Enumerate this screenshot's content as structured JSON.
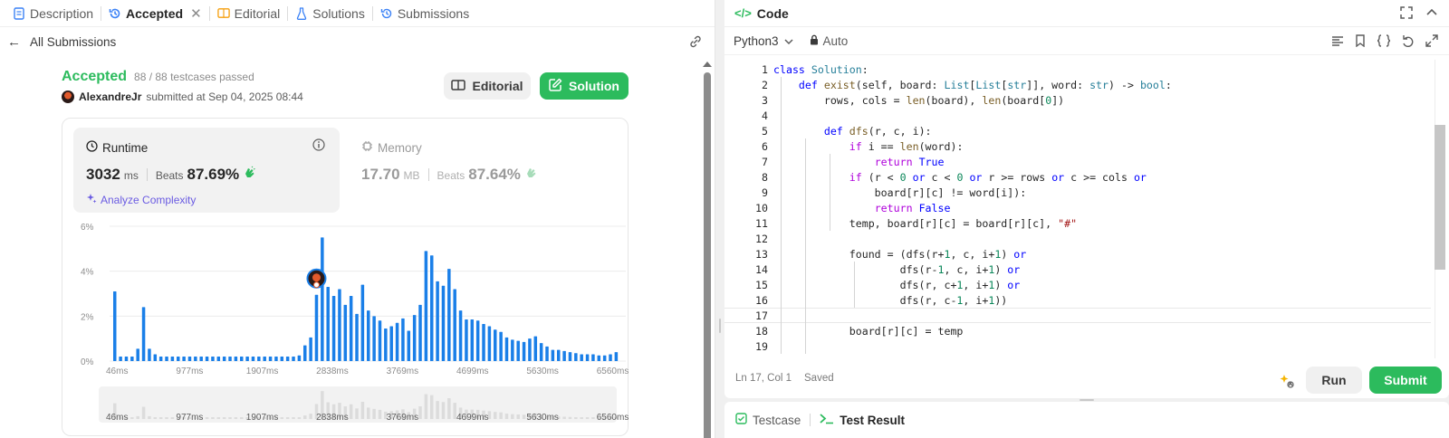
{
  "left_tabs": [
    {
      "label": "Description"
    },
    {
      "label": "Accepted"
    },
    {
      "label": "Editorial"
    },
    {
      "label": "Solutions"
    },
    {
      "label": "Submissions"
    }
  ],
  "back_label": "All Submissions",
  "submission": {
    "status": "Accepted",
    "testcases": "88 / 88 testcases passed",
    "author": "AlexandreJr",
    "submitted_text": "submitted at Sep 04, 2025 08:44"
  },
  "buttons": {
    "editorial": "Editorial",
    "solution": "Solution"
  },
  "runtime": {
    "label": "Runtime",
    "value": "3032",
    "unit": "ms",
    "beats_label": "Beats",
    "beats": "87.69%",
    "analyze": "Analyze Complexity"
  },
  "memory": {
    "label": "Memory",
    "value": "17.70",
    "unit": "MB",
    "beats_label": "Beats",
    "beats": "87.64%"
  },
  "chart_data": {
    "type": "bar",
    "y_ticks": [
      "6%",
      "4%",
      "2%",
      "0%"
    ],
    "ylim": [
      0,
      6
    ],
    "x_ticks": [
      "46ms",
      "977ms",
      "1907ms",
      "2838ms",
      "3769ms",
      "4699ms",
      "5630ms",
      "6560ms"
    ],
    "values": [
      3.1,
      0.2,
      0.2,
      0.2,
      0.55,
      2.4,
      0.55,
      0.3,
      0.2,
      0.2,
      0.2,
      0.2,
      0.2,
      0.2,
      0.2,
      0.2,
      0.2,
      0.2,
      0.2,
      0.2,
      0.2,
      0.2,
      0.2,
      0.2,
      0.2,
      0.2,
      0.2,
      0.2,
      0.2,
      0.2,
      0.2,
      0.2,
      0.25,
      0.7,
      1.05,
      2.95,
      5.5,
      3.3,
      2.9,
      3.2,
      2.5,
      2.9,
      2.1,
      3.4,
      2.25,
      2.0,
      1.8,
      1.45,
      1.55,
      1.7,
      1.9,
      1.35,
      2.05,
      2.5,
      4.9,
      4.7,
      3.55,
      3.35,
      4.1,
      3.2,
      2.25,
      1.85,
      1.85,
      1.8,
      1.65,
      1.55,
      1.4,
      1.3,
      1.05,
      0.95,
      0.9,
      0.85,
      1.0,
      1.1,
      0.8,
      0.65,
      0.5,
      0.5,
      0.45,
      0.4,
      0.35,
      0.3,
      0.3,
      0.3,
      0.25,
      0.25,
      0.3,
      0.4
    ],
    "highlight_index": 35,
    "color": "#1a7fe8"
  },
  "code_panel": {
    "title": "Code",
    "language": "Python3",
    "mode": "Auto",
    "status_pos": "Ln 17, Col 1",
    "status_saved": "Saved",
    "run": "Run",
    "submit": "Submit"
  },
  "code_lines": [
    {
      "n": "1",
      "html": "<span class=\"kw\">class</span> <span class=\"ty\">Solution</span>:"
    },
    {
      "n": "2",
      "html": "    <span class=\"kw\">def</span> <span class=\"fn\">exist</span>(self, board: <span class=\"ty\">List</span>[<span class=\"ty\">List</span>[<span class=\"ty\">str</span>]], word: <span class=\"ty\">str</span>) -> <span class=\"ty\">bool</span>:"
    },
    {
      "n": "3",
      "html": "        rows, cols = <span class=\"fn\">len</span>(board), <span class=\"fn\">len</span>(board[<span class=\"nm\">0</span>])"
    },
    {
      "n": "4",
      "html": ""
    },
    {
      "n": "5",
      "html": "        <span class=\"kw\">def</span> <span class=\"fn\">dfs</span>(r, c, i):"
    },
    {
      "n": "6",
      "html": "            <span class=\"cf\">if</span> i == <span class=\"fn\">len</span>(word):"
    },
    {
      "n": "7",
      "html": "                <span class=\"cf\">return</span> <span class=\"kw\">True</span>"
    },
    {
      "n": "8",
      "html": "            <span class=\"cf\">if</span> (r < <span class=\"nm\">0</span> <span class=\"kw\">or</span> c < <span class=\"nm\">0</span> <span class=\"kw\">or</span> r >= rows <span class=\"kw\">or</span> c >= cols <span class=\"kw\">or</span>"
    },
    {
      "n": "9",
      "html": "                board[r][c] != word[i]):"
    },
    {
      "n": "10",
      "html": "                <span class=\"cf\">return</span> <span class=\"kw\">False</span>"
    },
    {
      "n": "11",
      "html": "            temp, board[r][c] = board[r][c], <span class=\"st\">\"#\"</span>"
    },
    {
      "n": "12",
      "html": ""
    },
    {
      "n": "13",
      "html": "            found = (dfs(r+<span class=\"nm\">1</span>, c, i+<span class=\"nm\">1</span>) <span class=\"kw\">or</span>"
    },
    {
      "n": "14",
      "html": "                    dfs(r-<span class=\"nm\">1</span>, c, i+<span class=\"nm\">1</span>) <span class=\"kw\">or</span>"
    },
    {
      "n": "15",
      "html": "                    dfs(r, c+<span class=\"nm\">1</span>, i+<span class=\"nm\">1</span>) <span class=\"kw\">or</span>"
    },
    {
      "n": "16",
      "html": "                    dfs(r, c-<span class=\"nm\">1</span>, i+<span class=\"nm\">1</span>))"
    },
    {
      "n": "17",
      "html": ""
    },
    {
      "n": "18",
      "html": "            board[r][c] = temp"
    },
    {
      "n": "19",
      "html": ""
    }
  ],
  "bottom_tabs": {
    "testcase": "Testcase",
    "result": "Test Result"
  }
}
